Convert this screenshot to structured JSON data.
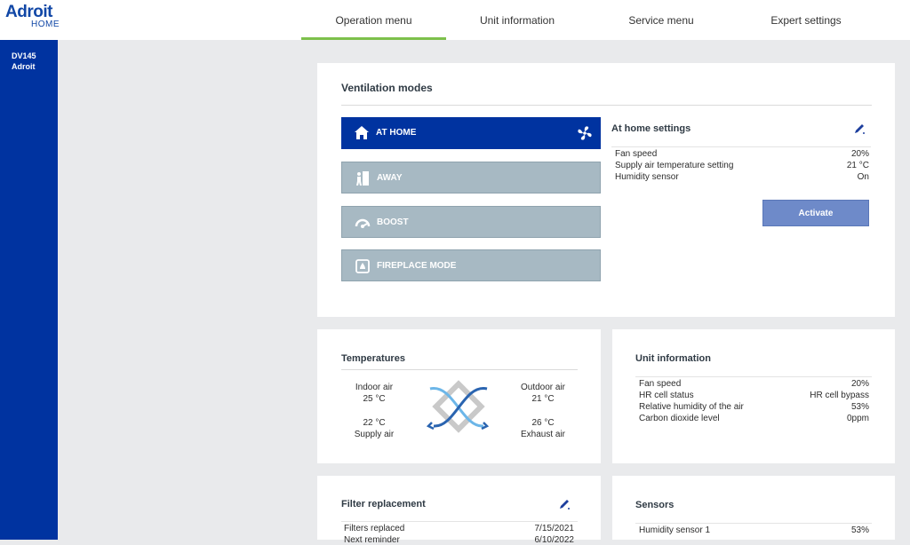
{
  "logo": {
    "brand": "Adroit",
    "sub": "HOME"
  },
  "nav": {
    "tabs": [
      "Operation menu",
      "Unit information",
      "Service menu",
      "Expert settings"
    ],
    "active_index": 0
  },
  "sidebar": {
    "model": "DV145",
    "name": "Adroit"
  },
  "ventilation": {
    "title": "Ventilation modes",
    "modes": [
      {
        "label": "AT HOME",
        "icon": "home-icon",
        "active": true
      },
      {
        "label": "AWAY",
        "icon": "away-icon",
        "active": false
      },
      {
        "label": "BOOST",
        "icon": "boost-icon",
        "active": false
      },
      {
        "label": "FIREPLACE MODE",
        "icon": "fireplace-icon",
        "active": false
      }
    ],
    "settings_title": "At home settings",
    "settings": [
      {
        "label": "Fan speed",
        "value": "20%"
      },
      {
        "label": "Supply air temperature setting",
        "value": "21 °C"
      },
      {
        "label": "Humidity sensor",
        "value": "On"
      }
    ],
    "activate_label": "Activate"
  },
  "temperatures": {
    "title": "Temperatures",
    "indoor_label": "Indoor air",
    "indoor_value": "25 °C",
    "outdoor_label": "Outdoor air",
    "outdoor_value": "21 °C",
    "supply_value": "22 °C",
    "supply_label": "Supply air",
    "exhaust_value": "26 °C",
    "exhaust_label": "Exhaust air"
  },
  "unit_info": {
    "title": "Unit information",
    "rows": [
      {
        "label": "Fan speed",
        "value": "20%"
      },
      {
        "label": "HR cell status",
        "value": "HR cell bypass"
      },
      {
        "label": "Relative humidity of the air",
        "value": "53%"
      },
      {
        "label": "Carbon dioxide level",
        "value": "0ppm"
      }
    ]
  },
  "filter": {
    "title": "Filter replacement",
    "rows": [
      {
        "label": "Filters replaced",
        "value": "7/15/2021"
      },
      {
        "label": "Next reminder",
        "value": "6/10/2022"
      }
    ]
  },
  "sensors": {
    "title": "Sensors",
    "rows": [
      {
        "label": "Humidity sensor 1",
        "value": "53%"
      }
    ]
  },
  "colors": {
    "accent": "#0033a0",
    "tab_underline": "#7dc04b",
    "inactive_mode": "#a7b9c3",
    "activate": "#6e8ac9"
  }
}
